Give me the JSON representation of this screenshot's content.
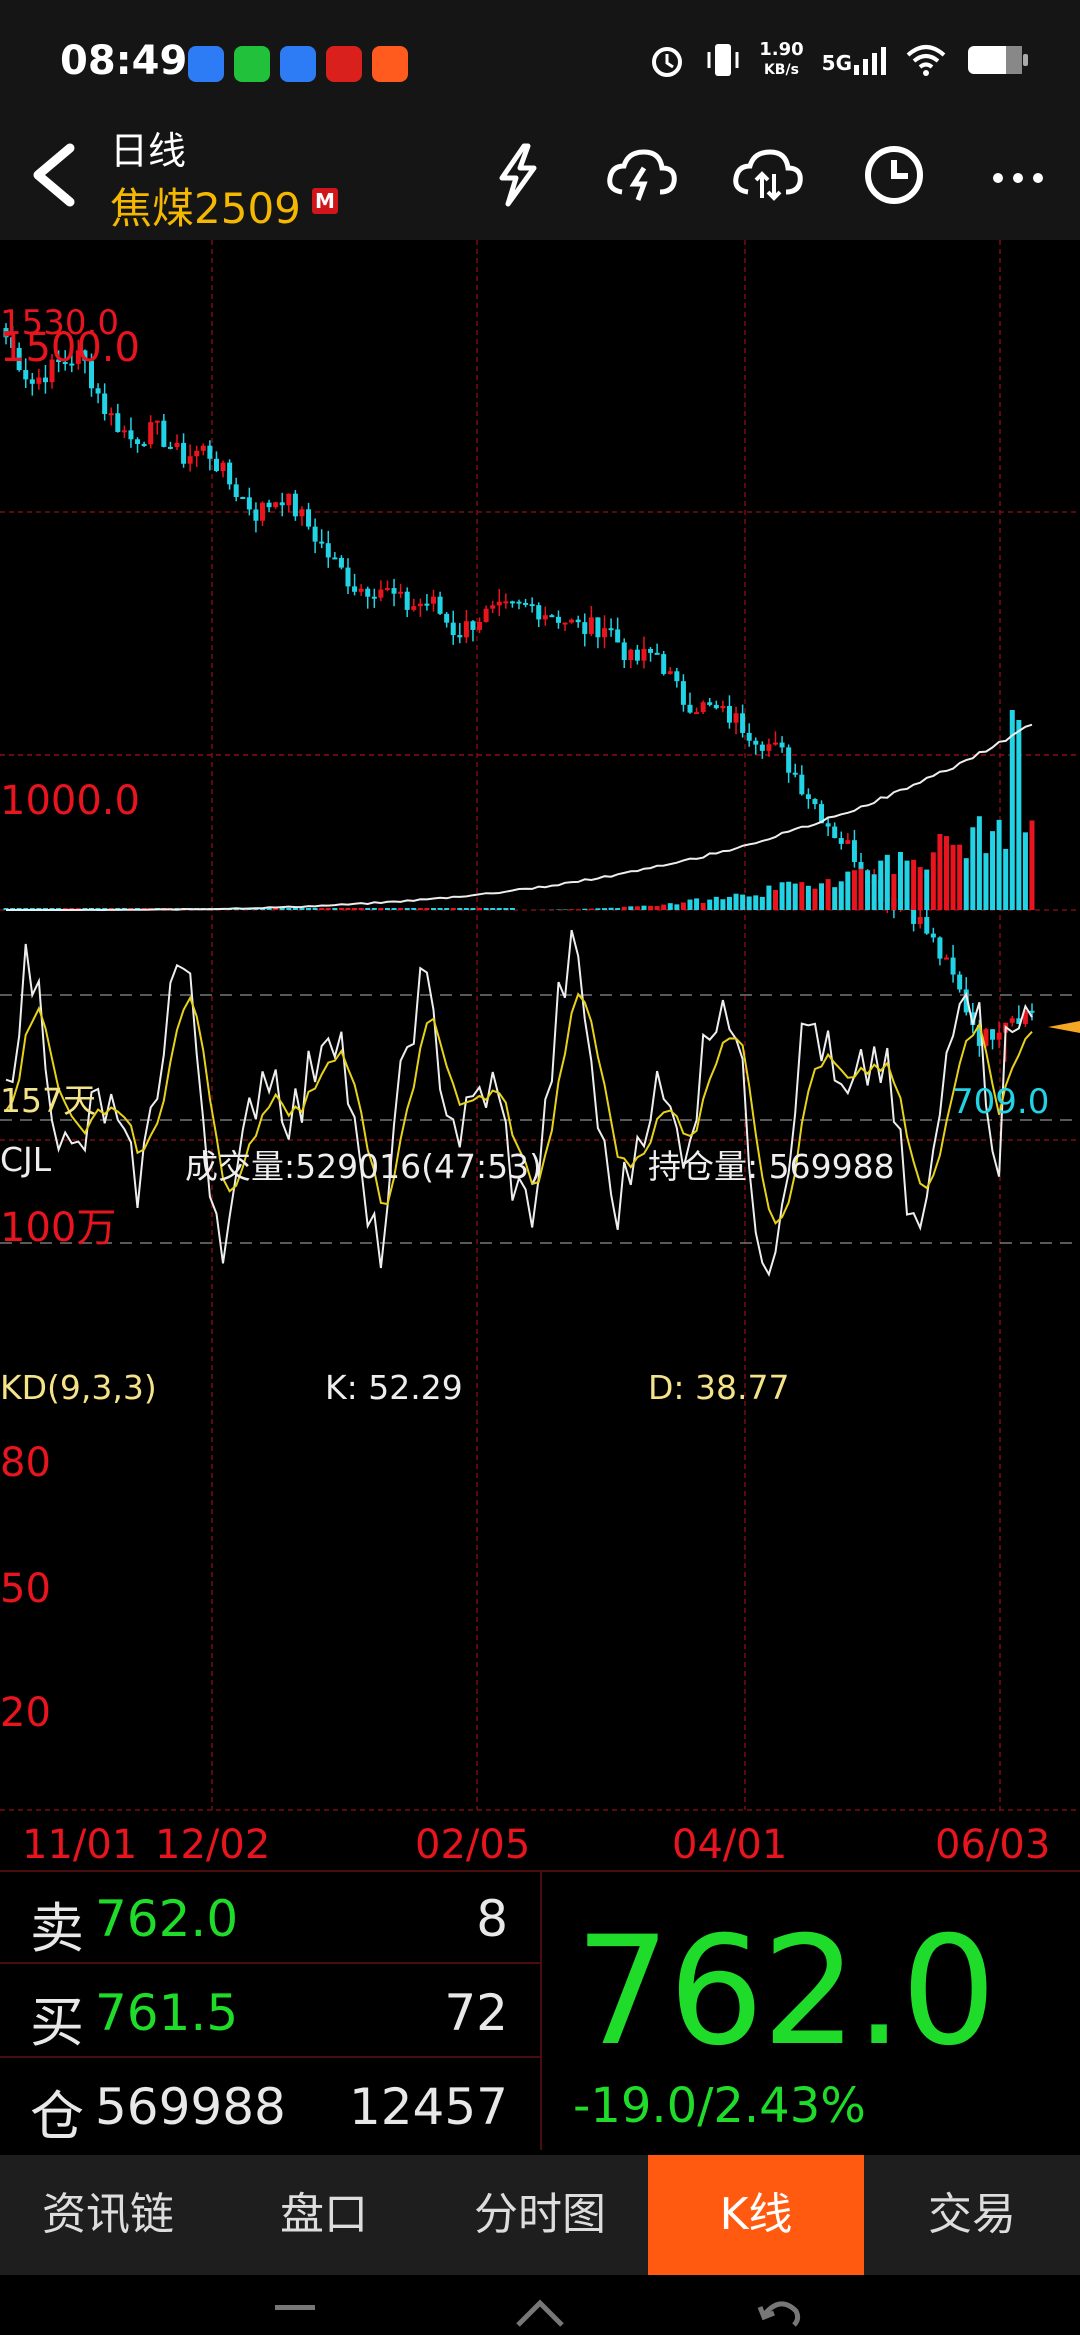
{
  "status": {
    "time": "08:49",
    "net_speed": "1.90",
    "net_unit": "KB/s",
    "network": "5G"
  },
  "header": {
    "title": "日线",
    "contract": "焦煤2509",
    "badge": "M"
  },
  "chart": {
    "price_top_label": "1530.0",
    "price_label_1500": "1500.0",
    "price_label_1000": "1000.0",
    "days_label": "157天",
    "low_label": "709.0",
    "volume_header": {
      "name": "CJL",
      "volume": "成交量:529016(47:53)",
      "open_interest": "持仓量: 569988",
      "scale": "100万"
    },
    "kd_header": {
      "name": "KD(9,3,3)",
      "k": "K: 52.29",
      "d": "D: 38.77",
      "lvl80": "80",
      "lvl50": "50",
      "lvl20": "20"
    },
    "dates": [
      "11/01",
      "12/02",
      "02/05",
      "04/01",
      "06/03"
    ]
  },
  "chart_data": {
    "type": "candlestick",
    "ylim": [
      700,
      1530
    ],
    "x_ticks": [
      "11/01",
      "12/02",
      "02/05",
      "04/01",
      "06/03"
    ],
    "low": 709.0,
    "last": 762.0,
    "close_series_approx": [
      1490,
      1440,
      1460,
      1470,
      1410,
      1380,
      1390,
      1360,
      1370,
      1330,
      1300,
      1320,
      1290,
      1250,
      1220,
      1220,
      1200,
      1205,
      1170,
      1190,
      1195,
      1200,
      1190,
      1175,
      1180,
      1140,
      1150,
      1100,
      1090,
      1080,
      1060,
      1040,
      1000,
      960,
      930,
      890,
      880,
      840,
      790,
      730,
      760,
      762
    ]
  },
  "quote": {
    "sell_label": "卖",
    "sell_price": "762.0",
    "sell_qty": "8",
    "buy_label": "买",
    "buy_price": "761.5",
    "buy_qty": "72",
    "oi_label": "仓",
    "oi_value": "569988",
    "oi_change": "12457",
    "last_price": "762.0",
    "change": "-19.0/2.43%"
  },
  "tabs": [
    "资讯链",
    "盘口",
    "分时图",
    "K线",
    "交易"
  ],
  "active_tab": "K线",
  "colors": {
    "up": "#e8141e",
    "down": "#22d3e6",
    "gain": "#1fdc2a",
    "accent": "#ff5a0f",
    "contract": "#f5b800"
  }
}
